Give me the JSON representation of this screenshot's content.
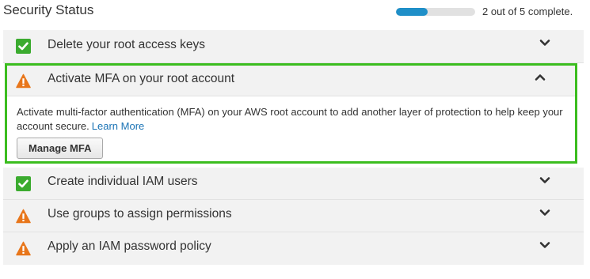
{
  "header": {
    "title": "Security Status",
    "progress_text": "2 out of 5 complete.",
    "progress_fraction": 0.4,
    "progress_color": "#1f8fc8"
  },
  "items": [
    {
      "label": "Delete your root access keys",
      "status": "complete",
      "icon": "check-icon",
      "expanded": false
    },
    {
      "label": "Activate MFA on your root account",
      "status": "warning",
      "icon": "warning-icon",
      "expanded": true,
      "description": "Activate multi-factor authentication (MFA) on your AWS root account to add another layer of protection to help keep your account secure.",
      "link_text": "Learn More",
      "button_label": "Manage MFA"
    },
    {
      "label": "Create individual IAM users",
      "status": "complete",
      "icon": "check-icon",
      "expanded": false
    },
    {
      "label": "Use groups to assign permissions",
      "status": "warning",
      "icon": "warning-icon",
      "expanded": false
    },
    {
      "label": "Apply an IAM password policy",
      "status": "warning",
      "icon": "warning-icon",
      "expanded": false
    }
  ],
  "colors": {
    "check_green": "#3bab2f",
    "warning_orange": "#e8761b",
    "highlight_border": "#3bbd1f",
    "link_blue": "#1a73b5"
  }
}
